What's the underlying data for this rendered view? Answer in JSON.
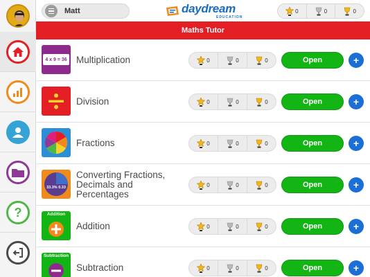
{
  "app": {
    "logo_text": "daydream",
    "logo_sub": "EDUCATION",
    "title": "Maths Tutor"
  },
  "user": {
    "name": "Matt"
  },
  "top_trophies": [
    {
      "icon": "gold-star-trophy-icon",
      "count": "0"
    },
    {
      "icon": "silver-trophy-icon",
      "count": "0"
    },
    {
      "icon": "gold-trophy-icon",
      "count": "0"
    }
  ],
  "sidebar": {
    "items": [
      {
        "name": "home",
        "icon": "home-icon",
        "color": "#e31e24"
      },
      {
        "name": "progress",
        "icon": "bar-chart-icon",
        "color": "#f08a1c"
      },
      {
        "name": "profile",
        "icon": "user-icon",
        "color": "#35a3d6"
      },
      {
        "name": "folder",
        "icon": "folder-icon",
        "color": "#8e3a96"
      },
      {
        "name": "help",
        "icon": "question-icon",
        "color": "#4cb848"
      },
      {
        "name": "logout",
        "icon": "logout-icon",
        "color": "#4a4a4a"
      }
    ]
  },
  "topics": [
    {
      "label": "Multiplication",
      "thumb_color": "#8e2a8e",
      "thumb_icon": "multiplication-icon",
      "thumb_caption": "4 x 9 = 36",
      "star": "0",
      "silver": "0",
      "gold": "0",
      "open_label": "Open",
      "add_label": "+"
    },
    {
      "label": "Division",
      "thumb_color": "#e31e24",
      "thumb_icon": "division-icon",
      "thumb_caption": "",
      "star": "0",
      "silver": "0",
      "gold": "0",
      "open_label": "Open",
      "add_label": "+"
    },
    {
      "label": "Fractions",
      "thumb_color": "#2a8fd6",
      "thumb_icon": "fractions-pie-icon",
      "thumb_caption": "",
      "star": "0",
      "silver": "0",
      "gold": "0",
      "open_label": "Open",
      "add_label": "+"
    },
    {
      "label": "Converting Fractions, Decimals and Percentages",
      "thumb_color": "#f08a1c",
      "thumb_icon": "converting-icon",
      "thumb_caption": "33.3%  0.33",
      "star": "0",
      "silver": "0",
      "gold": "0",
      "open_label": "Open",
      "add_label": "+"
    },
    {
      "label": "Addition",
      "thumb_color": "#13b514",
      "thumb_icon": "plus-icon",
      "thumb_caption": "Addition",
      "star": "0",
      "silver": "0",
      "gold": "0",
      "open_label": "Open",
      "add_label": "+"
    },
    {
      "label": "Subtraction",
      "thumb_color": "#13b514",
      "thumb_icon": "minus-icon",
      "thumb_caption": "Subtraction",
      "star": "0",
      "silver": "0",
      "gold": "0",
      "open_label": "Open",
      "add_label": "+"
    }
  ]
}
